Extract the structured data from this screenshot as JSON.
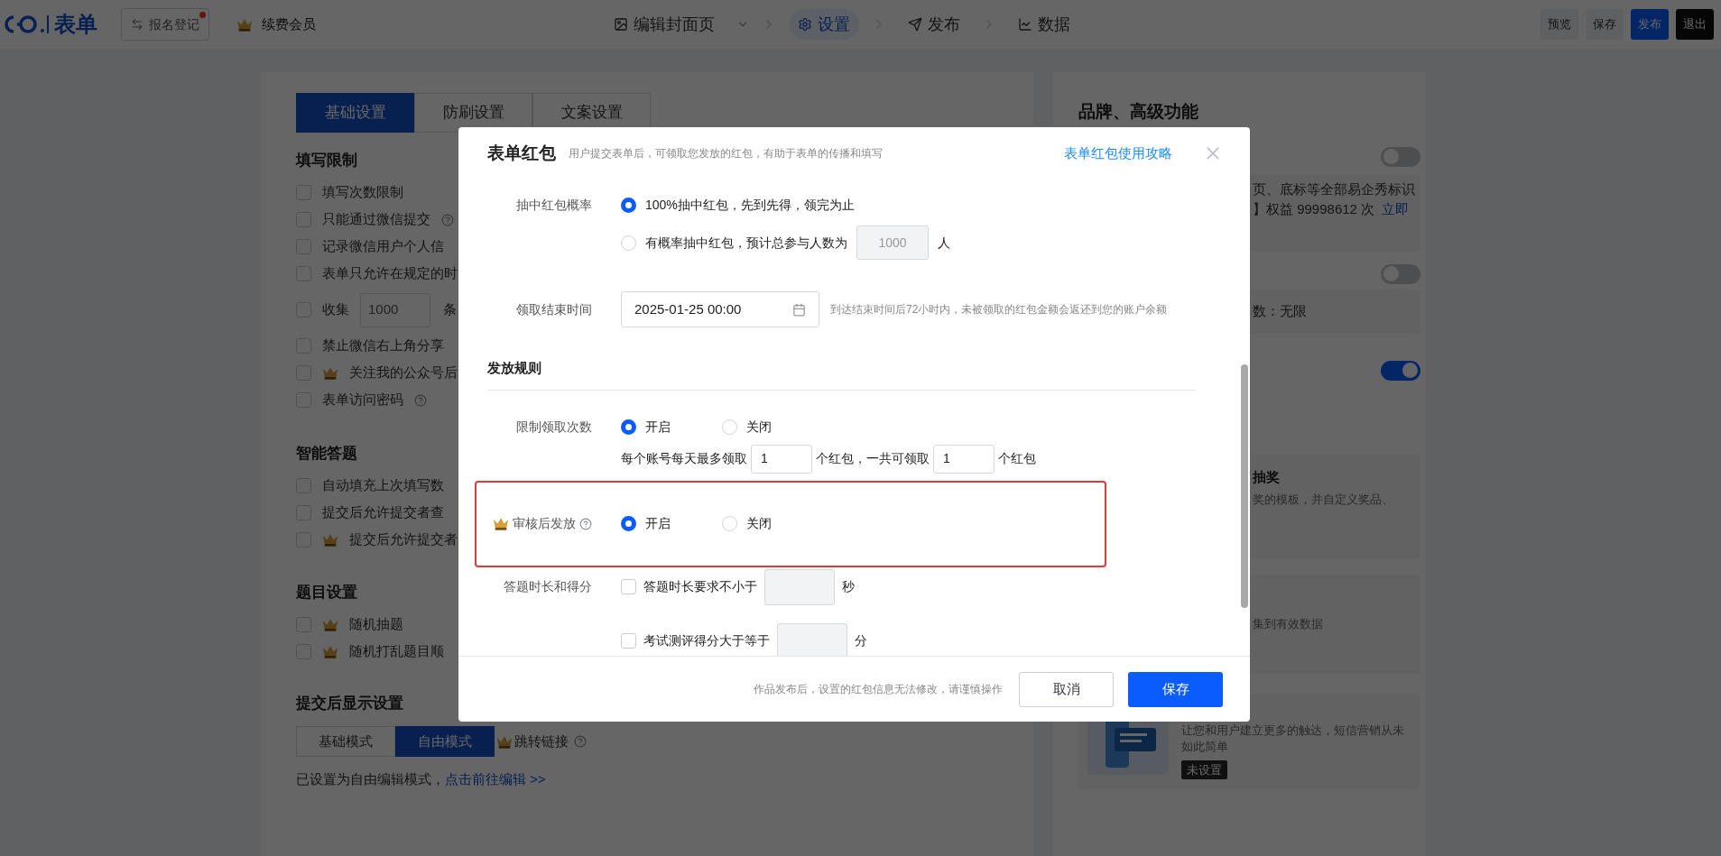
{
  "topbar": {
    "logo_text": "表单",
    "register_button": "报名登记",
    "member": "续费会员",
    "steps": [
      {
        "label": "编辑封面页",
        "selected": false
      },
      {
        "label": "设置",
        "selected": true
      },
      {
        "label": "发布",
        "selected": false
      },
      {
        "label": "数据",
        "selected": false
      }
    ],
    "actions": [
      {
        "label": "预览",
        "kind": "plain"
      },
      {
        "label": "保存",
        "kind": "plain"
      },
      {
        "label": "发布",
        "kind": "primary"
      },
      {
        "label": "退出",
        "kind": "dark"
      }
    ]
  },
  "left_panel": {
    "tabs": [
      {
        "label": "基础设置",
        "selected": true
      },
      {
        "label": "防刷设置",
        "selected": false
      },
      {
        "label": "文案设置",
        "selected": false
      }
    ],
    "sections": [
      {
        "title": "填写限制",
        "items": [
          {
            "kind": "checkbox",
            "label": "填写次数限制",
            "checked": false,
            "premium": false,
            "help": false
          },
          {
            "kind": "checkbox",
            "label": "只能通过微信提交",
            "checked": false,
            "premium": false,
            "help": true
          },
          {
            "kind": "checkbox",
            "label": "记录微信用户个人信",
            "checked": false,
            "premium": false,
            "help": false
          },
          {
            "kind": "checkbox",
            "label": "表单只允许在规定的时",
            "checked": false,
            "premium": false,
            "help": false
          },
          {
            "kind": "collect",
            "label": "收集",
            "value": "1000",
            "suffix": "条",
            "checked": false,
            "premium": false,
            "help": false
          },
          {
            "kind": "checkbox",
            "label": "禁止微信右上角分享",
            "checked": false,
            "premium": false,
            "help": false
          },
          {
            "kind": "checkbox",
            "label": "关注我的公众号后",
            "checked": false,
            "premium": true,
            "help": false
          },
          {
            "kind": "checkbox",
            "label": "表单访问密码",
            "checked": false,
            "premium": false,
            "help": true
          }
        ]
      },
      {
        "title": "智能答题",
        "items": [
          {
            "kind": "checkbox",
            "label": "自动填充上次填写数",
            "checked": false,
            "premium": false,
            "help": false
          },
          {
            "kind": "checkbox",
            "label": "提交后允许提交者查",
            "checked": false,
            "premium": false,
            "help": false
          },
          {
            "kind": "checkbox",
            "label": "提交后允许提交者",
            "checked": false,
            "premium": true,
            "help": false
          }
        ]
      },
      {
        "title": "题目设置",
        "items": [
          {
            "kind": "checkbox",
            "label": "随机抽题",
            "checked": false,
            "premium": true,
            "help": false
          },
          {
            "kind": "checkbox",
            "label": "随机打乱题目顺",
            "checked": false,
            "premium": true,
            "help": false
          }
        ]
      }
    ],
    "display_settings": {
      "title": "提交后显示设置",
      "modes": [
        {
          "label": "基础模式",
          "selected": false,
          "premium": false,
          "help": false
        },
        {
          "label": "自由模式",
          "selected": true,
          "premium": false,
          "help": false
        },
        {
          "label": "跳转链接",
          "selected": false,
          "premium": true,
          "help": true
        }
      ],
      "note": "已设置为自由编辑模式，",
      "link": "点击前往编辑 >>"
    }
  },
  "right_panel": {
    "title": "品牌、高级功能",
    "blocks": [
      {
        "kind": "toggle_card",
        "on": false,
        "lines": [
          "页、底标等全部易企秀标识",
          "】权益 99998612 次"
        ],
        "link": "立即"
      },
      {
        "kind": "toggle_card",
        "on": false,
        "lines": [
          "数：无限"
        ]
      },
      {
        "kind": "toggle",
        "on": true
      },
      {
        "kind": "card",
        "heading": "抽奖",
        "lines": [
          "奖的模板，并自定义奖品、"
        ]
      },
      {
        "kind": "card",
        "lines": [
          "集到有效数据"
        ]
      },
      {
        "kind": "promo",
        "text": "让您和用户建立更多的触达，短信营销从未如此简单",
        "badge": "未设置"
      }
    ]
  },
  "modal": {
    "title": "表单红包",
    "subtitle": "用户提交表单后，可领取您发放的红包，有助于表单的传播和填写",
    "guide_link": "表单红包使用攻略",
    "rows": [
      {
        "kind": "radios",
        "label": "抽中红包概率",
        "premium": false,
        "help": false,
        "highlighted": false,
        "options": [
          {
            "label": "100%抽中红包，先到先得，领完为止",
            "selected": true
          },
          {
            "label": "有概率抽中红包，预计总参与人数为",
            "selected": false,
            "input": "1000",
            "suffix": "人"
          }
        ]
      },
      {
        "kind": "date",
        "label": "领取结束时间",
        "premium": false,
        "help": false,
        "highlighted": false,
        "value": "2025-01-25 00:00",
        "hint": "到达结束时间后72小时内，未被领取的红包金额会返还到您的账户余额"
      },
      {
        "kind": "section",
        "label": "发放规则"
      },
      {
        "kind": "radios_inline",
        "label": "限制领取次数",
        "premium": false,
        "help": false,
        "highlighted": false,
        "options": [
          {
            "label": "开启",
            "selected": true
          },
          {
            "label": "关闭",
            "selected": false
          }
        ],
        "limit": {
          "prefix": "每个账号每天最多领取",
          "daily": "1",
          "middle": "个红包，一共可领取",
          "total": "1",
          "suffix": "个红包"
        }
      },
      {
        "kind": "radios_inline",
        "label": "审核后发放",
        "premium": true,
        "help": true,
        "highlighted": true,
        "options": [
          {
            "label": "开启",
            "selected": true
          },
          {
            "label": "关闭",
            "selected": false
          }
        ]
      },
      {
        "kind": "checks",
        "label": "答题时长和得分",
        "premium": false,
        "help": false,
        "highlighted": false,
        "options": [
          {
            "label": "答题时长要求不小于",
            "checked": false,
            "suffix": "秒"
          },
          {
            "label": "考试测评得分大于等于",
            "checked": false,
            "suffix": "分"
          }
        ]
      }
    ],
    "footer_note": "作品发布后，设置的红包信息无法修改，请谨慎操作",
    "cancel": "取消",
    "save": "保存"
  }
}
